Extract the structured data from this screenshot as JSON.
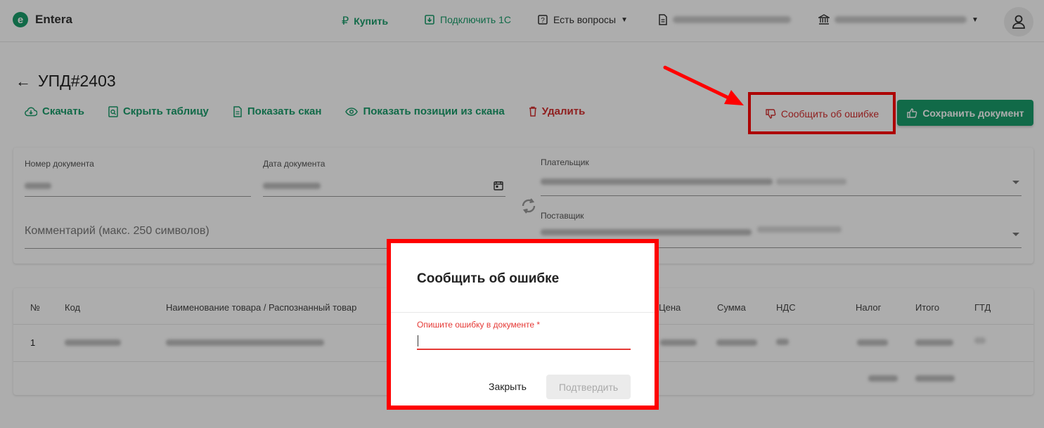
{
  "brand": {
    "name": "Entera"
  },
  "topbar": {
    "buy_label": "Купить",
    "connect_label": "Подключить 1С",
    "questions_label": "Есть вопросы"
  },
  "page": {
    "title": "УПД#2403"
  },
  "actions": {
    "download": "Скачать",
    "hide_table": "Скрыть таблицу",
    "show_scan": "Показать скан",
    "show_positions": "Показать позиции из скана",
    "delete": "Удалить",
    "report_error": "Сообщить об ошибке",
    "save_document": "Сохранить документ"
  },
  "form": {
    "doc_number_label": "Номер документа",
    "doc_date_label": "Дата документа",
    "payer_label": "Плательщик",
    "supplier_label": "Поставщик",
    "comment_placeholder": "Комментарий (макс. 250 символов)"
  },
  "table": {
    "columns": [
      "№",
      "Код",
      "Наименование товара / Распознанный товар",
      "Цена",
      "Сумма",
      "НДС",
      "Налог",
      "Итого",
      "ГТД"
    ],
    "rows": [
      {
        "num": "1"
      }
    ]
  },
  "dialog": {
    "title": "Сообщить об ошибке",
    "field_label": "Опишите ошибку в документе *",
    "input_value": "",
    "close_label": "Закрыть",
    "confirm_label": "Подтвердить"
  },
  "colors": {
    "accent": "#1a9c6b",
    "danger": "#d32f2f",
    "highlight": "#ff0000"
  }
}
